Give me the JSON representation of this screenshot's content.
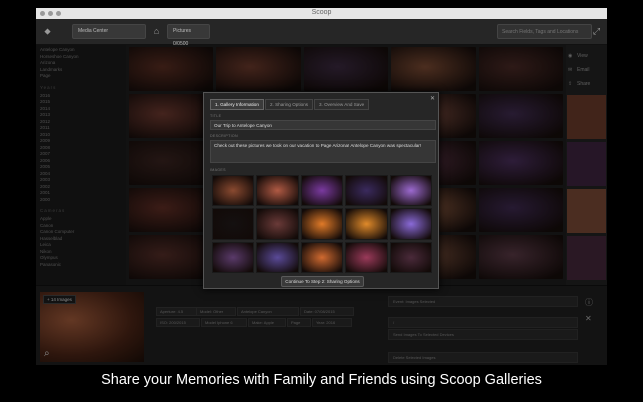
{
  "window": {
    "title": "Scoop"
  },
  "toolbar": {
    "library_button": "Media Center",
    "pictures_button": "Pictures 0/0500",
    "search_placeholder": "Search Fields, Tags and Locations"
  },
  "sidebar": {
    "top_items": [
      "Antelope Canyon",
      "Horseshoe Canyon",
      "Arizona",
      "Landmarks",
      "Page"
    ],
    "year_group": "Years",
    "years": [
      "2016",
      "2015",
      "2014",
      "2013",
      "2012",
      "2011",
      "2010",
      "2009",
      "2008",
      "2007",
      "2006",
      "2005",
      "2004",
      "2003",
      "2002",
      "2001",
      "2000"
    ],
    "camera_group": "Cameras",
    "cameras": [
      "Apple",
      "Canon",
      "Canon Computer",
      "Hasselblad",
      "Leica",
      "Nikon",
      "Olympus",
      "Panasonic"
    ]
  },
  "grid": {
    "tiles": [
      "#5a2e22",
      "#6b3a2c",
      "#3b2a40",
      "#7a4a33",
      "#4a2a26",
      "#6e3a30",
      "#9a5c38",
      "#5e3f70",
      "#7a4b3e",
      "#402c50",
      "#3a2420",
      "#1e1310",
      "#2b1c22",
      "#533040",
      "#4a2f5c",
      "#602e25",
      "#7b4a3a",
      "#4b2f48",
      "#8b5a40",
      "#3e2a50",
      "#552e28",
      "#6a3e30",
      "#4e3358",
      "#7a503c",
      "#5a3a46"
    ]
  },
  "right_panel": {
    "actions": [
      {
        "icon": "eye-icon",
        "glyph": "◉",
        "label": "View"
      },
      {
        "icon": "mail-icon",
        "glyph": "✉",
        "label": "Email"
      },
      {
        "icon": "share-icon",
        "glyph": "⇪",
        "label": "Share"
      }
    ]
  },
  "bottom": {
    "preview_count": "+ 14 Images",
    "meta": {
      "aperture": "Aperture: 4.5",
      "camera": "Model: Other",
      "location": "Antelope Canyon",
      "date": "Date: 07/08/2015",
      "iso": "ISO: 200/2015",
      "exposure": "Model Iphone 6",
      "city": "Make: Apple",
      "country": "Page",
      "year": "Year: 2016"
    },
    "fields": {
      "event": "Event: Images Selected",
      "tag": "/",
      "add_images": "Send Images To Selected Devices",
      "delete": "Delete Selected Images"
    }
  },
  "dialog": {
    "tabs": [
      "1. Gallery Information",
      "2. Sharing Options",
      "3. Overview And Save"
    ],
    "title_label": "TITLE",
    "title_value": "Our Trip to Antelope Canyon",
    "description_label": "DESCRIPTION",
    "description_value": "Check out these pictures we took on our vacation to Page Arizona!  Antelope Canyon was spectacular!",
    "images_label": "IMAGES",
    "continue_button": "Continue To Step 2: Sharing Options",
    "image_colors": [
      "#8a4a30",
      "#b05a44",
      "#7a3aa0",
      "#3a2a5e",
      "#9c6ad0",
      "#141010",
      "#6a3a38",
      "#e07a28",
      "#e08a2a",
      "#8a6ad8",
      "#5a3a6a",
      "#5a4a98",
      "#d06a30",
      "#9a3a5a",
      "#4a2a3a"
    ]
  },
  "caption": "Share your Memories with Family and Friends using Scoop Galleries"
}
